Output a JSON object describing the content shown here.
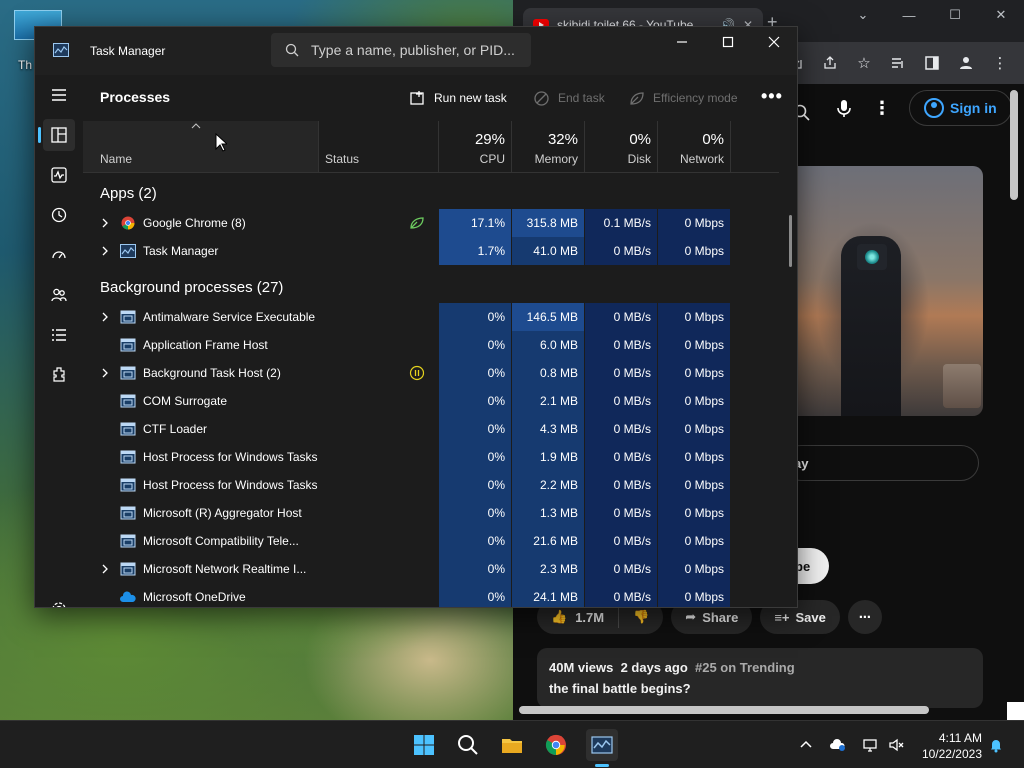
{
  "desktop": {
    "icon_label": "Th"
  },
  "chrome": {
    "tab_title": "skibidi toilet 66 - YouTube",
    "sign_in": "Sign in",
    "pill_play": "ay",
    "pill_sub": "be",
    "likes": "1.7M",
    "share": "Share",
    "save": "Save",
    "views": "40M views",
    "age": "2 days ago",
    "trending": "#25 on Trending",
    "video_title": "the final battle begins?"
  },
  "task_manager": {
    "title": "Task Manager",
    "search_placeholder": "Type a name, publisher, or PID...",
    "page_title": "Processes",
    "commands": {
      "run_new_task": "Run new task",
      "end_task": "End task",
      "efficiency_mode": "Efficiency mode"
    },
    "columns": {
      "name": "Name",
      "status": "Status",
      "cpu": {
        "label": "CPU",
        "pct": "29%"
      },
      "memory": {
        "label": "Memory",
        "pct": "32%"
      },
      "disk": {
        "label": "Disk",
        "pct": "0%"
      },
      "network": {
        "label": "Network",
        "pct": "0%"
      }
    },
    "apps_group": "Apps (2)",
    "bg_group": "Background processes (27)",
    "apps": [
      {
        "name": "Google Chrome (8)",
        "cpu": "17.1%",
        "memory": "315.8 MB",
        "disk": "0.1 MB/s",
        "network": "0 Mbps"
      },
      {
        "name": "Task Manager",
        "cpu": "1.7%",
        "memory": "41.0 MB",
        "disk": "0 MB/s",
        "network": "0 Mbps"
      }
    ],
    "background": [
      {
        "name": "Antimalware Service Executable",
        "cpu": "0%",
        "memory": "146.5 MB",
        "disk": "0 MB/s",
        "network": "0 Mbps"
      },
      {
        "name": "Application Frame Host",
        "cpu": "0%",
        "memory": "6.0 MB",
        "disk": "0 MB/s",
        "network": "0 Mbps"
      },
      {
        "name": "Background Task Host (2)",
        "cpu": "0%",
        "memory": "0.8 MB",
        "disk": "0 MB/s",
        "network": "0 Mbps"
      },
      {
        "name": "COM Surrogate",
        "cpu": "0%",
        "memory": "2.1 MB",
        "disk": "0 MB/s",
        "network": "0 Mbps"
      },
      {
        "name": "CTF Loader",
        "cpu": "0%",
        "memory": "4.3 MB",
        "disk": "0 MB/s",
        "network": "0 Mbps"
      },
      {
        "name": "Host Process for Windows Tasks",
        "cpu": "0%",
        "memory": "1.9 MB",
        "disk": "0 MB/s",
        "network": "0 Mbps"
      },
      {
        "name": "Host Process for Windows Tasks",
        "cpu": "0%",
        "memory": "2.2 MB",
        "disk": "0 MB/s",
        "network": "0 Mbps"
      },
      {
        "name": "Microsoft (R) Aggregator Host",
        "cpu": "0%",
        "memory": "1.3 MB",
        "disk": "0 MB/s",
        "network": "0 Mbps"
      },
      {
        "name": "Microsoft Compatibility Tele...",
        "cpu": "0%",
        "memory": "21.6 MB",
        "disk": "0 MB/s",
        "network": "0 Mbps"
      },
      {
        "name": "Microsoft Network Realtime I...",
        "cpu": "0%",
        "memory": "2.3 MB",
        "disk": "0 MB/s",
        "network": "0 Mbps"
      },
      {
        "name": "Microsoft OneDrive",
        "cpu": "0%",
        "memory": "24.1 MB",
        "disk": "0 MB/s",
        "network": "0 Mbps"
      }
    ]
  },
  "taskbar": {
    "time": "4:11 AM",
    "date": "10/22/2023"
  },
  "colors": {
    "accent": "#4cc2ff",
    "heat_high": "#1e4b8f",
    "heat_mid": "#163a70",
    "heat_low": "#10285a"
  }
}
